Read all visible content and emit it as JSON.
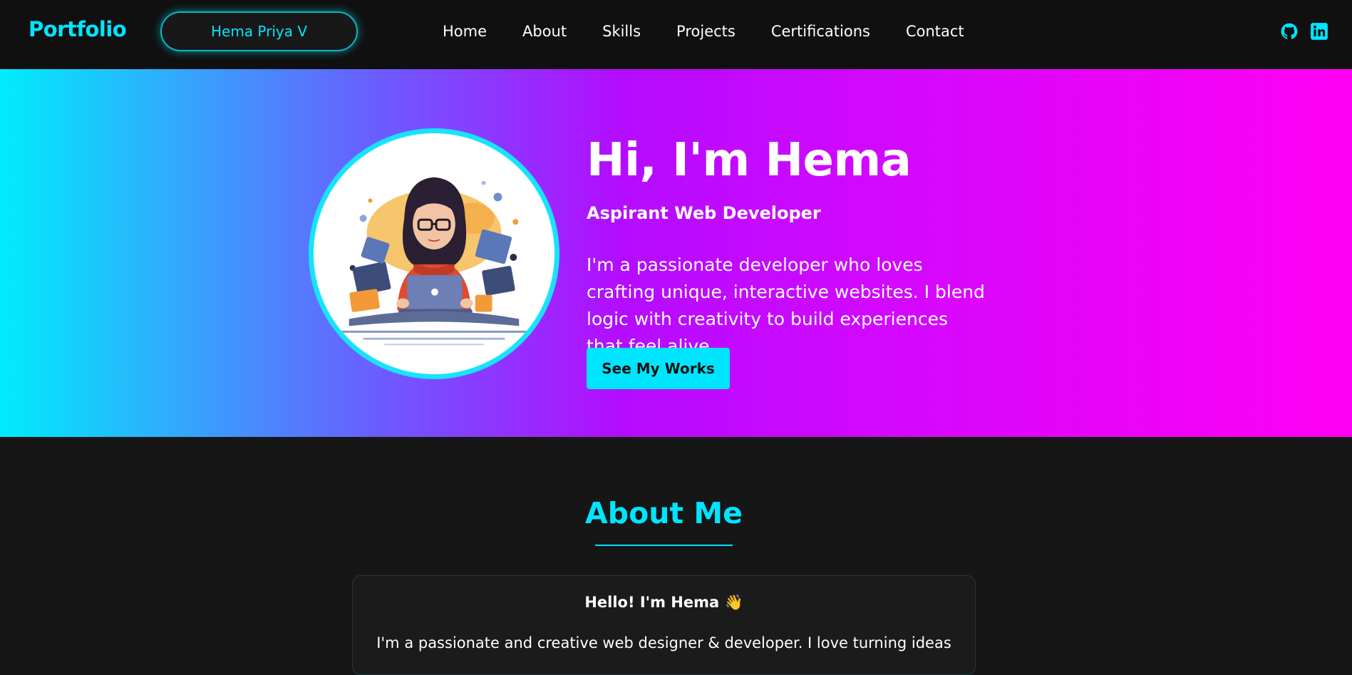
{
  "header": {
    "brand": "Portfolio",
    "name_pill": "Hema Priya V",
    "nav": [
      "Home",
      "About",
      "Skills",
      "Projects",
      "Certifications",
      "Contact"
    ],
    "socials": [
      "github-icon",
      "linkedin-icon"
    ]
  },
  "hero": {
    "title": "Hi, I'm Hema",
    "subtitle": "Aspirant Web Developer",
    "description": "I'm a passionate developer who loves crafting unique, interactive websites. I blend logic with creativity to build experiences that feel alive.",
    "button": "See My Works"
  },
  "about": {
    "title": "About Me",
    "hello": "Hello! I'm Hema 👋",
    "text": "I'm a passionate and creative web designer & developer. I love turning ideas"
  },
  "colors": {
    "accent": "#00e5ff",
    "gradient_start": "#00ecfb",
    "gradient_mid": "#b40cff",
    "gradient_end": "#ff00f2",
    "background": "#161616",
    "header_bg": "#101010"
  }
}
